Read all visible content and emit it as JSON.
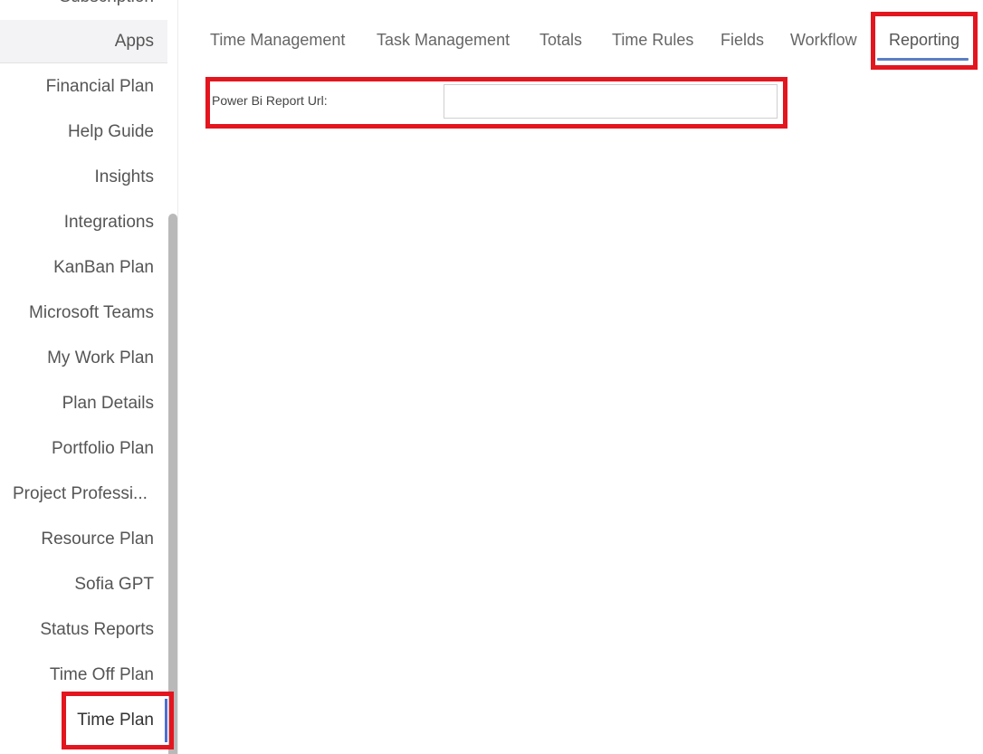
{
  "sidebar": {
    "items": [
      {
        "label": "Subscription"
      },
      {
        "label": "Apps"
      },
      {
        "label": "Financial Plan"
      },
      {
        "label": "Help Guide"
      },
      {
        "label": "Insights"
      },
      {
        "label": "Integrations"
      },
      {
        "label": "KanBan Plan"
      },
      {
        "label": "Microsoft Teams"
      },
      {
        "label": "My Work Plan"
      },
      {
        "label": "Plan Details"
      },
      {
        "label": "Portfolio Plan"
      },
      {
        "label": "Project Professi..."
      },
      {
        "label": "Resource Plan"
      },
      {
        "label": "Sofia GPT"
      },
      {
        "label": "Status Reports"
      },
      {
        "label": "Time Off Plan"
      },
      {
        "label": "Time Plan"
      }
    ],
    "active_item": "Time Plan"
  },
  "tabs": [
    {
      "label": "Time Management"
    },
    {
      "label": "Task Management"
    },
    {
      "label": "Totals"
    },
    {
      "label": "Time Rules"
    },
    {
      "label": "Fields"
    },
    {
      "label": "Workflow"
    },
    {
      "label": "Reporting"
    }
  ],
  "active_tab": "Reporting",
  "form": {
    "power_bi_label": "Power Bi Report Url:",
    "power_bi_value": ""
  },
  "colors": {
    "highlight": "#e3161f",
    "active_tab_underline": "#5b7fc4",
    "sidebar_active_marker": "#4d6fd0",
    "scrollbar_thumb": "#b9b9b9"
  }
}
